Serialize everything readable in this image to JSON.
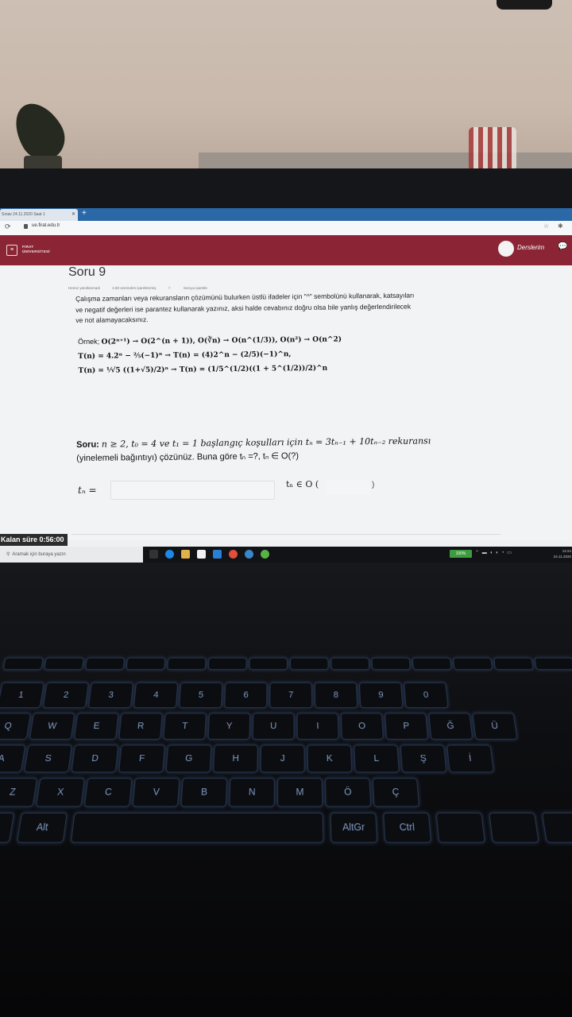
{
  "browser": {
    "tab_title": "Sınav 24.11.2020 Saat 1",
    "new_tab": "+",
    "url": "ue.firat.edu.tr"
  },
  "site_header": {
    "university_name_line1": "FIRAT",
    "university_name_line2": "ÜNİVERSİTESİ",
    "nav_link": "Derslerim"
  },
  "question": {
    "title": "Soru 9",
    "meta_status": "Henüz yanıtlanmadı",
    "meta_points": "2,50 üzerinden işaretlenmiş",
    "meta_flag": "Soruyu işaretle",
    "instructions": [
      "Çalışma zamanları veya rekuransların çözümünü bulurken üstlü ifadeler için \"^\" sembolünü kullanarak, katsayıları",
      "ve negatif değerleri ise parantez kullanarak yazınız, aksi halde cevabınız doğru olsa bile yanlış değerlendirilecek",
      "ve not alamayacaksınız."
    ],
    "example_label": "Örnek;",
    "example_line1": "O(2ⁿ⁺¹) → O(2^(n + 1)),  O(∛n) → O(n^(1/3)), O(n²) → O(n^2)",
    "example_line2": "T(n) = 4.2ⁿ − ²⁄₅(−1)ⁿ → T(n) = (4)2^n − (2/5)(−1)^n,",
    "example_line3": "T(n) = ¹⁄√5 ((1+√5)/2)ⁿ → T(n) = (1/5^(1/2)((1 + 5^(1/2))/2)^n",
    "soru_label": "Soru:",
    "soru_text_line1": "n ≥ 2,  t₀ = 4 ve t₁ = 1  başlangıç koşulları için  tₙ = 3tₙ₋₁ + 10tₙ₋₂  rekuransı",
    "soru_text_line2": "(yinelemeli bağıntıyı) çözünüz.  Buna göre tₙ =?,  tₙ ∈ O(?)",
    "answer_label": "tₙ =",
    "answer_value": "",
    "order_label": "tₙ ∈ O (",
    "order_value": "",
    "order_close": ")"
  },
  "timer": {
    "text": "Kalan süre 0:56:00"
  },
  "taskbar": {
    "search_placeholder": "Aramak için buraya yazın",
    "battery": "100%",
    "clock_time": "12:24",
    "clock_date": "24.11.2020"
  },
  "keyboard": {
    "row_numbers": [
      "1",
      "2",
      "3",
      "4",
      "5",
      "6",
      "7",
      "8",
      "9",
      "0"
    ],
    "row_q": [
      "Q",
      "W",
      "E",
      "R",
      "T",
      "Y",
      "U",
      "I",
      "O",
      "P",
      "Ğ",
      "Ü"
    ],
    "row_a": [
      "A",
      "S",
      "D",
      "F",
      "G",
      "H",
      "J",
      "K",
      "L",
      "Ş",
      "İ"
    ],
    "row_z": [
      "Z",
      "X",
      "C",
      "V",
      "B",
      "N",
      "M",
      "Ö",
      "Ç"
    ],
    "alt": "Alt",
    "altgr": "AltGr",
    "ctrl": "Ctrl"
  }
}
